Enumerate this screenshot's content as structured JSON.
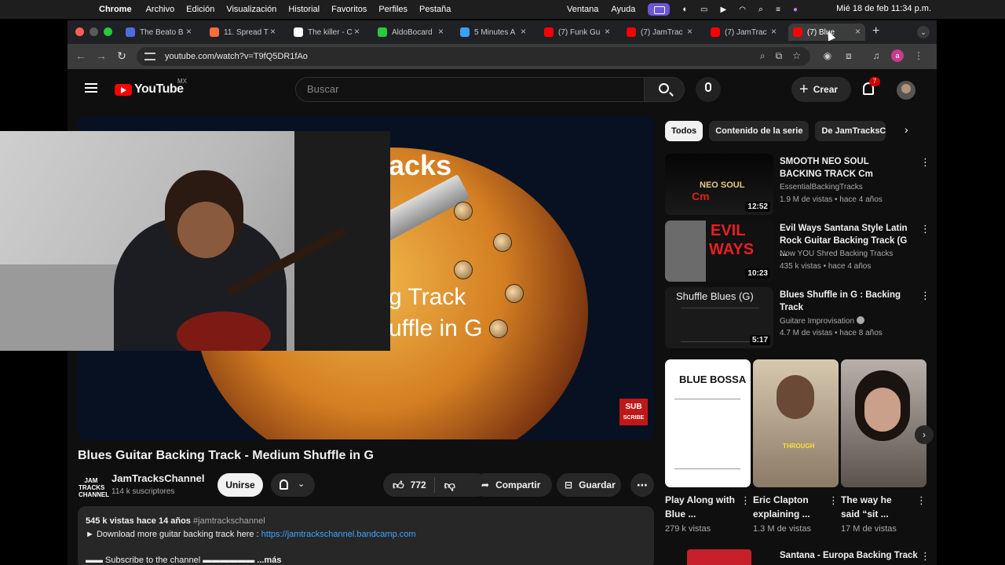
{
  "menubar": {
    "app": "Chrome",
    "items": [
      "Archivo",
      "Edición",
      "Visualización",
      "Historial",
      "Favoritos",
      "Perfiles",
      "Pestaña"
    ],
    "right_items": [
      "Ventana",
      "Ayuda"
    ],
    "clock": "Mié 18 de feb  11:34 p.m."
  },
  "tabs": [
    {
      "label": "The Beato B",
      "color": "#4a6ee0"
    },
    {
      "label": "11. Spread T",
      "color": "#ff6b3d"
    },
    {
      "label": "The killer - C",
      "color": "#ffffff"
    },
    {
      "label": "AldoBocard",
      "color": "#27c93f"
    },
    {
      "label": "5 Minutes A",
      "color": "#3aa0ff"
    },
    {
      "label": "(7) Funk Gu",
      "color": "#ff0000"
    },
    {
      "label": "(7) JamTrac",
      "color": "#ff0000"
    },
    {
      "label": "(7) JamTrac",
      "color": "#ff0000"
    },
    {
      "label": "(7) Blue",
      "color": "#ff0000"
    }
  ],
  "omnibox": {
    "url": "youtube.com/watch?v=T9fQ5DR1fAo"
  },
  "yt": {
    "logo_word": "YouTube",
    "region": "MX",
    "search_placeholder": "Buscar",
    "create_label": "Crear",
    "notifications": "7"
  },
  "video": {
    "overlay_line1": "acks",
    "overlay_line2": "g Track",
    "overlay_line3": "uffle in G",
    "sub_logo_1": "SUB",
    "sub_logo_2": "SCRIBE",
    "title": "Blues Guitar Backing Track - Medium Shuffle in G",
    "channel": "JamTracksChannel",
    "channel_avatar": "JAM TRACKS CHANNEL",
    "subscribers": "114 k suscriptores",
    "join_label": "Unirse",
    "likes": "772",
    "share_label": "Compartir",
    "save_label": "Guardar",
    "desc_meta": "545 k vistas  hace 14 años",
    "desc_tag": "#jamtrackschannel",
    "desc_line1": "► Download more guitar backing track here : ",
    "desc_link": "https://jamtrackschannel.bandcamp.com",
    "desc_line2": "▬▬ Subscribe to the channel ▬▬▬▬▬▬",
    "desc_more": "...más"
  },
  "chips": [
    "Todos",
    "Contenido de la serie",
    "De JamTracksC"
  ],
  "recommendations": [
    {
      "title": "SMOOTH NEO SOUL BACKING TRACK Cm",
      "channel": "EssentialBackingTracks",
      "stats": "1.9 M de vistas • hace 4 años",
      "duration": "12:52",
      "thumb_text": "NEO SOUL",
      "thumb_text2": "Cm"
    },
    {
      "title": "Evil Ways Santana Style Latin Rock Guitar Backing Track (G ...",
      "channel": "Now YOU Shred Backing Tracks",
      "stats": "435 k vistas • hace 4 años",
      "duration": "10:23",
      "thumb_text": "EVIL",
      "thumb_text2": "WAYS"
    },
    {
      "title": "Blues Shuffle in G : Backing Track",
      "channel": "Guitare Improvisation",
      "stats": "4.7 M de vistas • hace 8 años",
      "duration": "5:17",
      "thumb_text": "Shuffle Blues (G)",
      "thumb_text2": ""
    }
  ],
  "shorts": [
    {
      "title": "Play Along with Blue ...",
      "views": "279 k vistas",
      "thumb_text": "BLUE BOSSA"
    },
    {
      "title": "Eric Clapton explaining ...",
      "views": "1.3 M de vistas",
      "thumb_text": "THROUGH"
    },
    {
      "title": "The way he said “sit ...",
      "views": "17 M de vistas",
      "thumb_text": ""
    }
  ],
  "last_recommendation": {
    "title": "Santana - Europa Backing Track"
  }
}
